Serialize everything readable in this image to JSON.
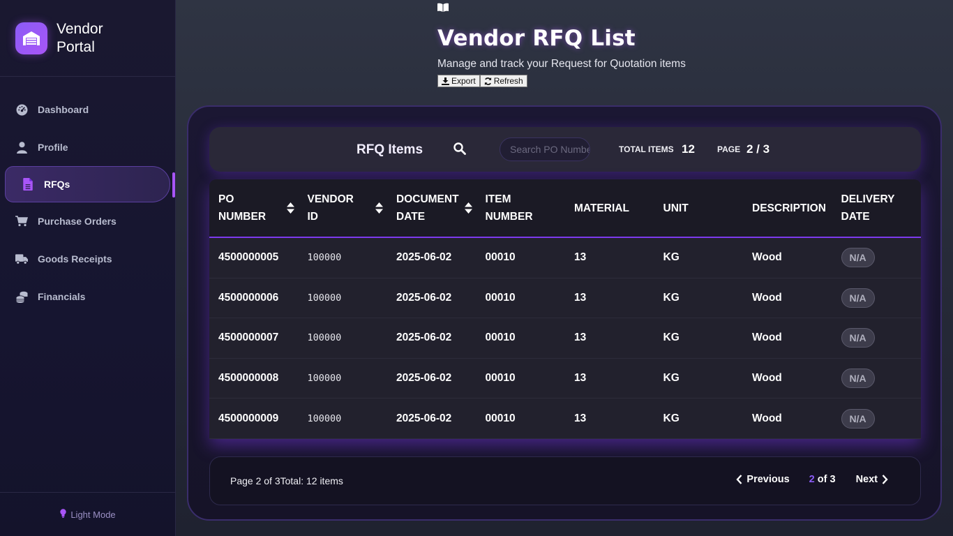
{
  "brand": {
    "title_line1": "Vendor",
    "title_line2": "Portal"
  },
  "nav": {
    "items": [
      {
        "label": "Dashboard",
        "icon": "dashboard-gauge-icon"
      },
      {
        "label": "Profile",
        "icon": "user-icon"
      },
      {
        "label": "RFQs",
        "icon": "file-icon",
        "active": true
      },
      {
        "label": "Purchase Orders",
        "icon": "cart-icon"
      },
      {
        "label": "Goods Receipts",
        "icon": "truck-icon"
      },
      {
        "label": "Financials",
        "icon": "coins-icon"
      }
    ],
    "footer": "Light Mode"
  },
  "header": {
    "title": "Vendor RFQ List",
    "subtitle": "Manage and track your Request for Quotation items",
    "export_label": "Export",
    "refresh_label": "Refresh"
  },
  "toolbar": {
    "title": "RFQ Items",
    "search_placeholder": "Search PO Number",
    "total_label": "TOTAL ITEMS",
    "total_value": "12",
    "page_label": "PAGE",
    "page_value": "2 / 3"
  },
  "table": {
    "columns": [
      {
        "line1": "PO",
        "line2": "NUMBER",
        "sortable": true
      },
      {
        "line1": "VENDOR",
        "line2": "ID",
        "sortable": true
      },
      {
        "line1": "DOCUMENT",
        "line2": "DATE",
        "sortable": true
      },
      {
        "line1": "ITEM",
        "line2": "NUMBER",
        "sortable": false
      },
      {
        "line1": "MATERIAL",
        "line2": "",
        "sortable": false
      },
      {
        "line1": "UNIT",
        "line2": "",
        "sortable": false
      },
      {
        "line1": "DESCRIPTION",
        "line2": "",
        "sortable": false
      },
      {
        "line1": "DELIVERY",
        "line2": "DATE",
        "sortable": false
      }
    ],
    "rows": [
      [
        "4500000005",
        "100000",
        "2025-06-02",
        "00010",
        "13",
        "KG",
        "Wood",
        "N/A"
      ],
      [
        "4500000006",
        "100000",
        "2025-06-02",
        "00010",
        "13",
        "KG",
        "Wood",
        "N/A"
      ],
      [
        "4500000007",
        "100000",
        "2025-06-02",
        "00010",
        "13",
        "KG",
        "Wood",
        "N/A"
      ],
      [
        "4500000008",
        "100000",
        "2025-06-02",
        "00010",
        "13",
        "KG",
        "Wood",
        "N/A"
      ],
      [
        "4500000009",
        "100000",
        "2025-06-02",
        "00010",
        "13",
        "KG",
        "Wood",
        "N/A"
      ]
    ]
  },
  "footer": {
    "page_info": "Page 2 of 3",
    "total_info": "Total: 12 items",
    "previous_label": "Previous",
    "current_page": "2",
    "of_label": "of 3",
    "next_label": "Next"
  },
  "colors": {
    "accent": "#a855f7",
    "accent_dark": "#7c3aed"
  }
}
